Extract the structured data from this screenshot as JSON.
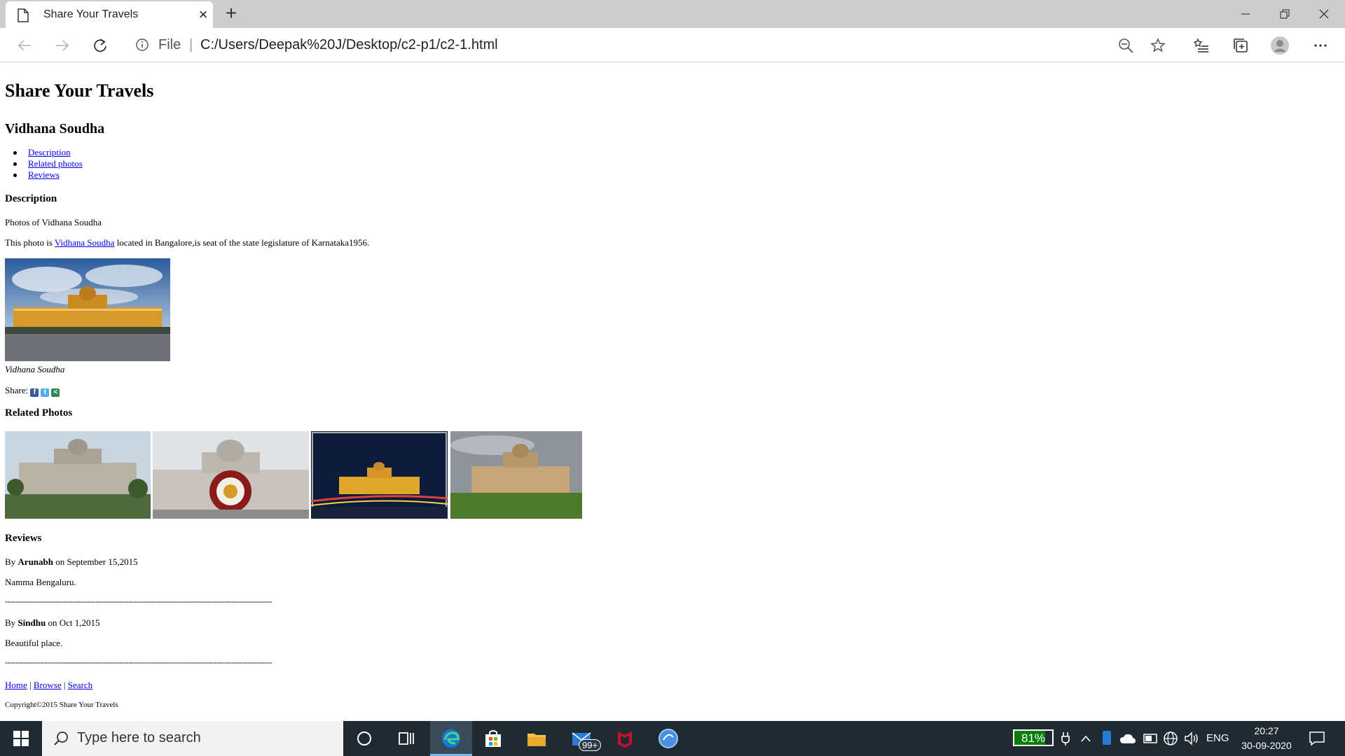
{
  "browser": {
    "tab_title": "Share Your Travels",
    "address_scheme": "File",
    "address_url": "C:/Users/Deepak%20J/Desktop/c2-p1/c2-1.html"
  },
  "page": {
    "heading": "Share Your Travels",
    "subheading": "Vidhana Soudha",
    "nav_links": [
      "Description",
      "Related photos",
      "Reviews"
    ],
    "description": {
      "heading": "Description",
      "intro": "Photos of Vidhana Soudha",
      "sentence_before": "This photo is ",
      "link_text": "Vidhana Soudha",
      "sentence_after": " located in Bangalore,is seat of the state legislature of Karnataka1956."
    },
    "main_photo_caption": "Vidhana Soudha",
    "share_label": "Share:",
    "related": {
      "heading": "Related Photos"
    },
    "reviews": {
      "heading": "Reviews",
      "items": [
        {
          "by": "By ",
          "author": "Arunabh",
          "date": " on September 15,2015",
          "text": "Namma Bengaluru."
        },
        {
          "by": "By ",
          "author": "Sindhu",
          "date": " on Oct 1,2015",
          "text": "Beautiful place."
        }
      ],
      "divider": "----------------------------------------------------------------------------------------------------------"
    },
    "footer": {
      "links": [
        "Home",
        "Browse",
        "Search"
      ],
      "separator": " | ",
      "copyright": "Copyright©2015 Share Your Travels"
    }
  },
  "taskbar": {
    "search_placeholder": "Type here to search",
    "mail_badge": "99+",
    "battery_percent": "81%",
    "battery_level": 0.81,
    "language": "ENG",
    "time": "20:27",
    "date": "30-09-2020"
  }
}
